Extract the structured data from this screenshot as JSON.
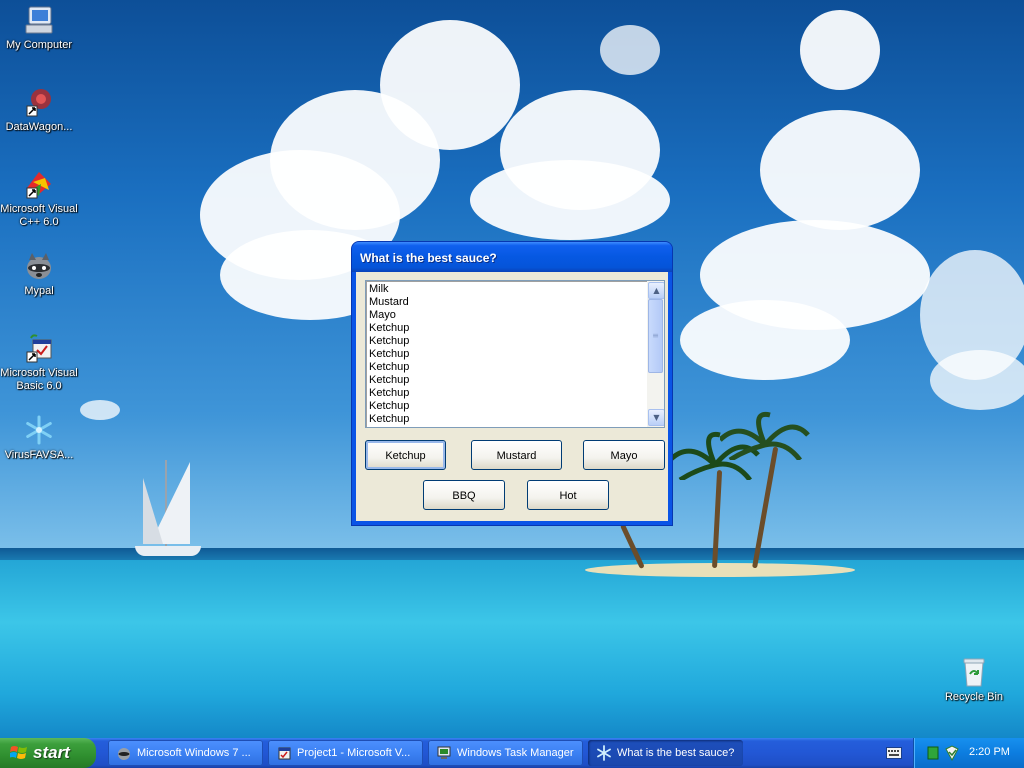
{
  "desktop": {
    "icons": [
      {
        "label": "My Computer"
      },
      {
        "label": "DataWagon..."
      },
      {
        "label": "Microsoft Visual C++ 6.0"
      },
      {
        "label": "Mypal"
      },
      {
        "label": "Microsoft Visual Basic 6.0"
      },
      {
        "label": "VirusFAVSA..."
      },
      {
        "label": "Recycle Bin"
      }
    ]
  },
  "dialog": {
    "title": "What is the best sauce?",
    "list_items": [
      "Milk",
      "Mustard",
      "Mayo",
      "Ketchup",
      "Ketchup",
      "Ketchup",
      "Ketchup",
      "Ketchup",
      "Ketchup",
      "Ketchup",
      "Ketchup"
    ],
    "buttons": {
      "ketchup": "Ketchup",
      "mustard": "Mustard",
      "mayo": "Mayo",
      "bbq": "BBQ",
      "hot": "Hot"
    }
  },
  "taskbar": {
    "start_label": "start",
    "tasks": [
      {
        "label": "Microsoft Windows 7 ..."
      },
      {
        "label": "Project1 - Microsoft V..."
      },
      {
        "label": "Windows Task Manager"
      },
      {
        "label": "What is the best sauce?"
      }
    ],
    "clock": "2:20 PM"
  },
  "colors": {
    "title_bar": "#0654e0",
    "start_green": "#3c9f3c",
    "taskbar_blue": "#245edb"
  }
}
